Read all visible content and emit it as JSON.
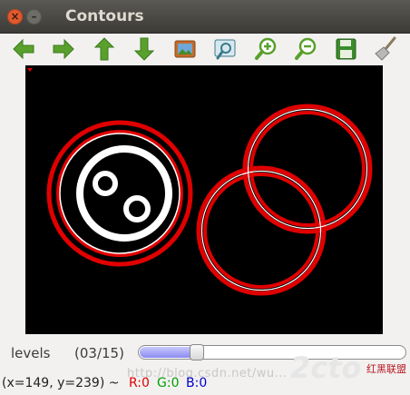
{
  "window": {
    "title": "Contours",
    "close_glyph": "×",
    "minimize_glyph": "–"
  },
  "toolbar": {
    "buttons": [
      {
        "name": "back-icon",
        "color": "#5aa02c"
      },
      {
        "name": "forward-icon",
        "color": "#5aa02c"
      },
      {
        "name": "up-icon",
        "color": "#5aa02c"
      },
      {
        "name": "down-icon",
        "color": "#5aa02c"
      },
      {
        "name": "save-image-icon",
        "color": "#c46a2a"
      },
      {
        "name": "zoom-region-icon",
        "color": "#3a7a8a"
      },
      {
        "name": "zoom-in-icon",
        "color": "#5aa02c"
      },
      {
        "name": "zoom-out-icon",
        "color": "#5aa02c"
      },
      {
        "name": "save-icon",
        "color": "#3c8c2c"
      },
      {
        "name": "broom-icon",
        "color": "#9a9a9a"
      }
    ]
  },
  "controls": {
    "levels_label": "levels",
    "levels_value": "(03/15)",
    "slider_level": 0.2
  },
  "status": {
    "coords": "(x=149, y=239) ~",
    "r": "R:0",
    "g": "G:0",
    "b": "B:0",
    "r_color": "#e00000",
    "g_color": "#00a000",
    "b_color": "#0000cc"
  },
  "watermark": {
    "text": "http://blog.csdn.net/wu...",
    "logo_text": "2cto",
    "logo_sub": "红黑联盟"
  }
}
